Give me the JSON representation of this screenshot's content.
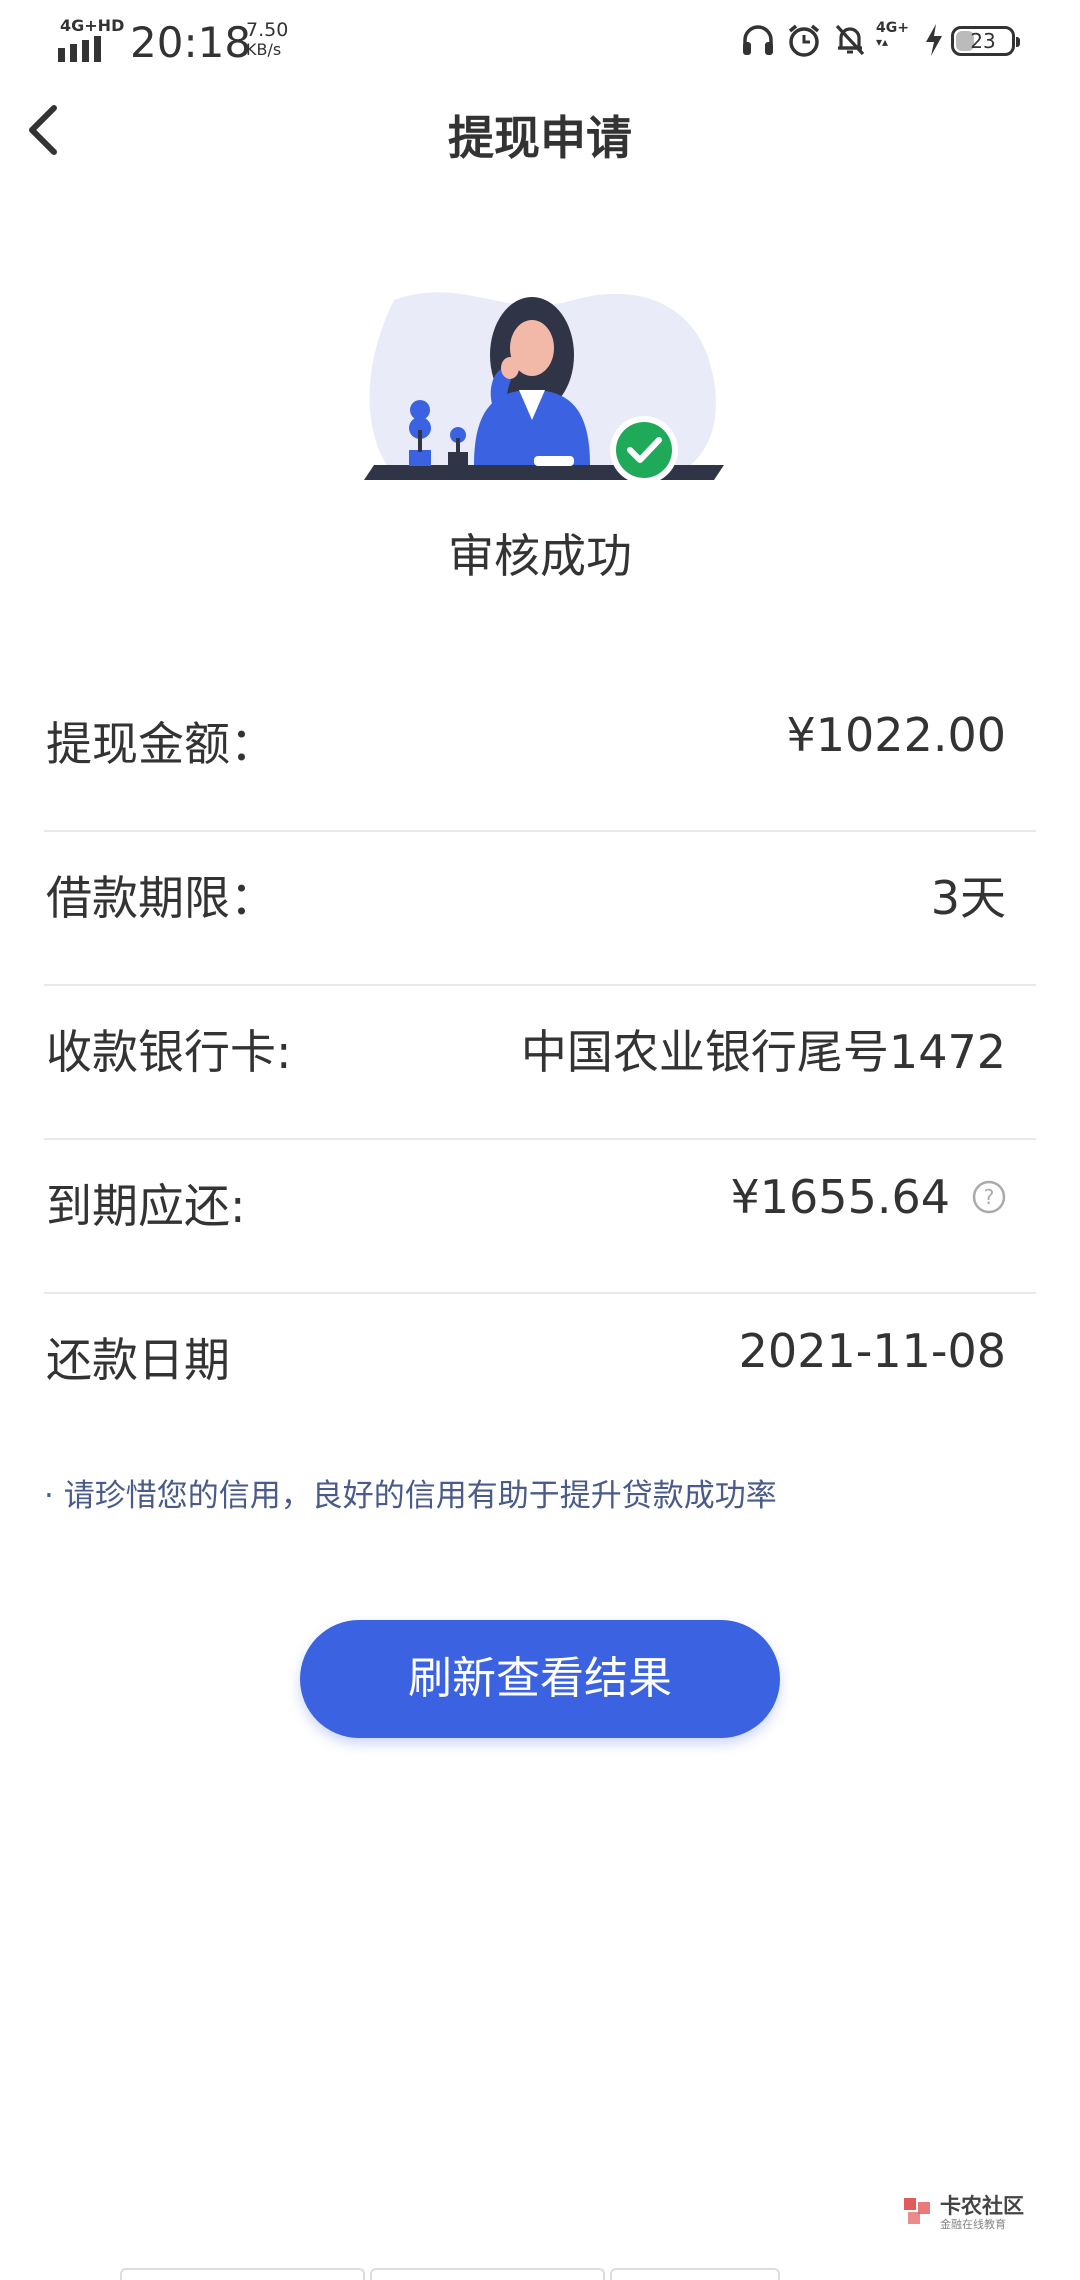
{
  "status_bar": {
    "network": "4G+HD",
    "time": "20:18",
    "speed_value": "7.50",
    "speed_unit": "KB/s",
    "network2": "4G+",
    "battery": "23",
    "icons": [
      "signal-icon",
      "headphones-icon",
      "alarm-icon",
      "mute-bell-icon",
      "network-4g-icon",
      "charging-icon",
      "battery-icon"
    ]
  },
  "nav": {
    "title": "提现申请",
    "back_icon": "chevron-left-icon"
  },
  "status": {
    "text": "审核成功",
    "illustration": "woman-at-desk-with-checkmark"
  },
  "details": [
    {
      "label": "提现金额：",
      "value": "¥1022.00"
    },
    {
      "label": "借款期限：",
      "value": "3天"
    },
    {
      "label": "收款银行卡:",
      "value": "中国农业银行尾号1472"
    },
    {
      "label": "到期应还:",
      "value": "¥1655.64",
      "help_icon": "question-circle-icon"
    },
    {
      "label": "还款日期",
      "value": "2021-11-08"
    }
  ],
  "tip": "· 请珍惜您的信用，良好的信用有助于提升贷款成功率",
  "refresh_button": "刷新查看结果",
  "watermark": {
    "title": "卡农社区",
    "subtitle": "金融在线教育"
  },
  "colors": {
    "primary": "#3b62e0",
    "success": "#1faa5a",
    "tip_text": "#4a5a8a"
  }
}
